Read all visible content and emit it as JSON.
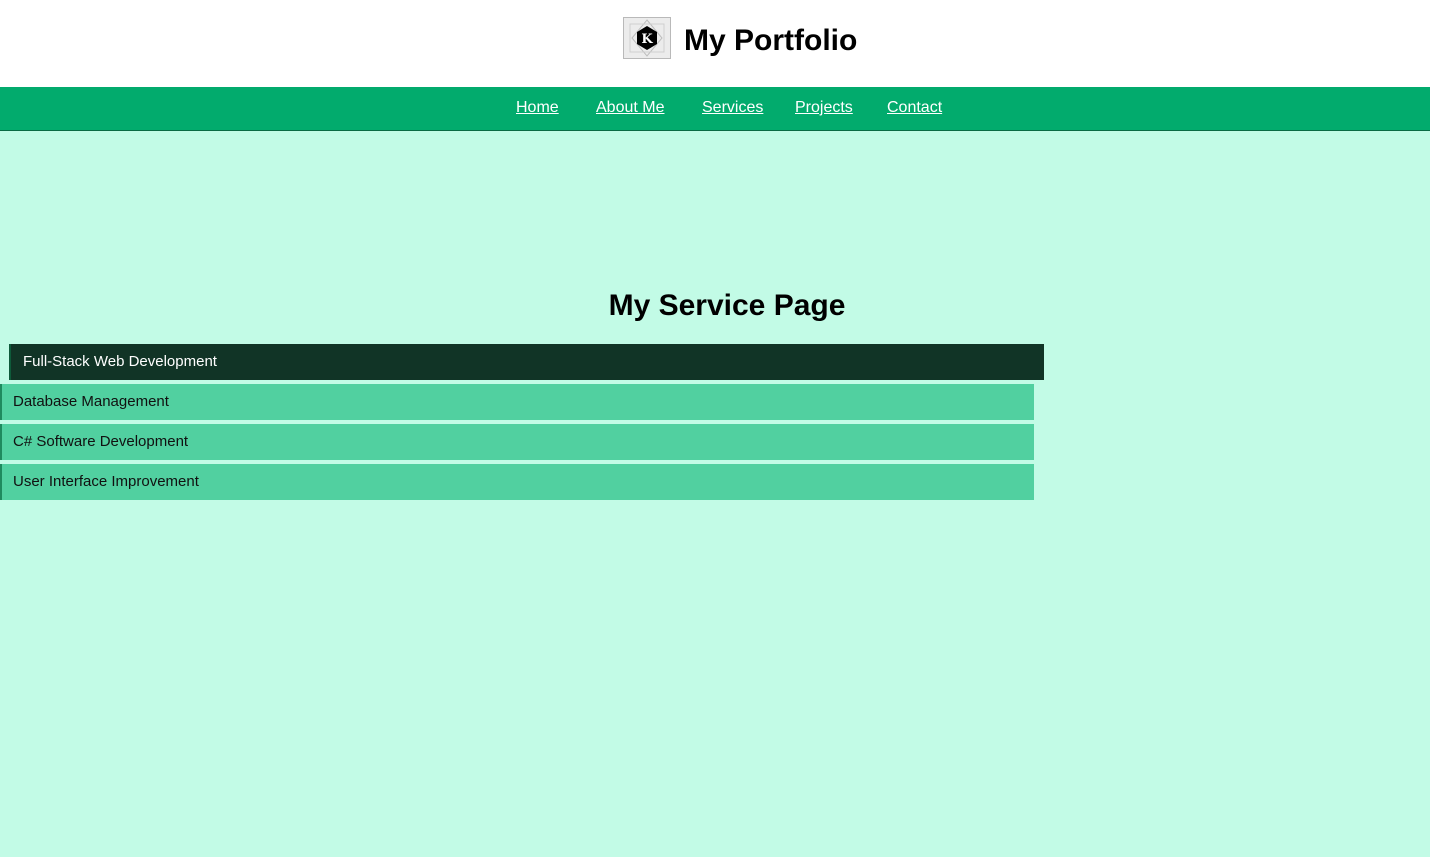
{
  "header": {
    "logo_icon": "k-hexagon-logo-icon",
    "title": "My Portfolio"
  },
  "nav": {
    "items": [
      {
        "label": "Home"
      },
      {
        "label": "About Me"
      },
      {
        "label": "Services"
      },
      {
        "label": "Projects"
      },
      {
        "label": "Contact"
      }
    ]
  },
  "main": {
    "heading": "My Service Page",
    "services": [
      {
        "label": "Full-Stack Web Development",
        "active": true
      },
      {
        "label": "Database Management",
        "active": false
      },
      {
        "label": "C# Software Development",
        "active": false
      },
      {
        "label": "User Interface Improvement",
        "active": false
      }
    ]
  },
  "colors": {
    "page_background": "#c2fbe6",
    "nav_background": "#02ab6d",
    "service_active": "#113426",
    "service_normal": "#51d0a0"
  }
}
